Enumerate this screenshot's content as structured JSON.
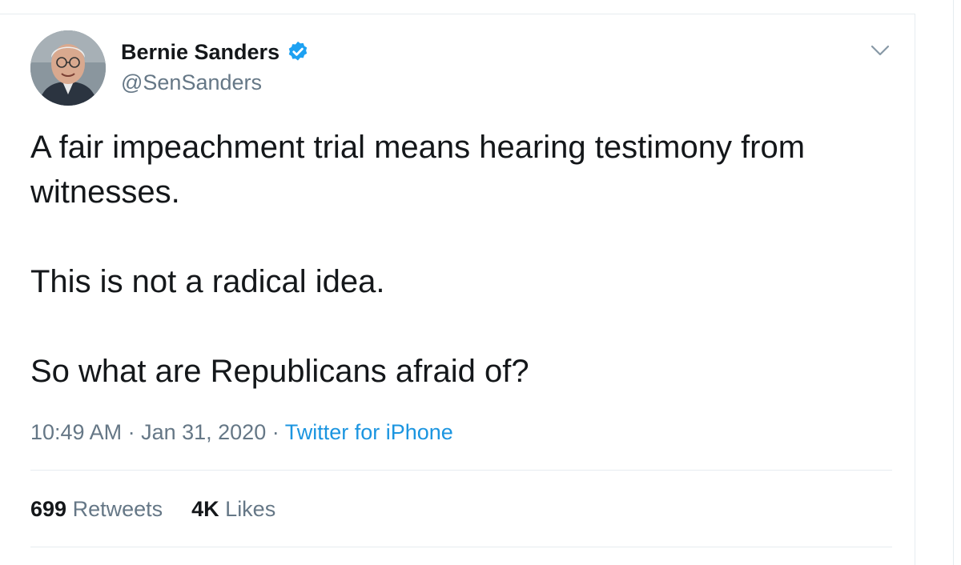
{
  "author": {
    "display_name": "Bernie Sanders",
    "handle": "@SenSanders",
    "verified": true,
    "verified_color": "#1da1f2"
  },
  "tweet": {
    "lines": [
      "A fair impeachment trial means hearing testimony from",
      "witnesses.",
      "This is not a radical idea.",
      "So what are Republicans afraid of?"
    ]
  },
  "meta": {
    "time": "10:49 AM",
    "separator": " · ",
    "date": "Jan 31, 2020",
    "source": "Twitter for iPhone"
  },
  "stats": {
    "retweets_count": "699",
    "retweets_label": "Retweets",
    "likes_count": "4K",
    "likes_label": "Likes"
  },
  "colors": {
    "link": "#1b95e0",
    "secondary_text": "#657786",
    "primary_text": "#14171a",
    "divider": "#e6ecf0"
  }
}
